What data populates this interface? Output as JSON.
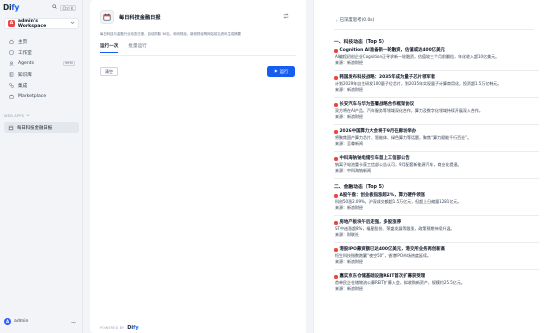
{
  "sidebar": {
    "logo": {
      "prefix": "Di",
      "accent": "fy"
    },
    "shortcut": "Ctrl K",
    "workspace": {
      "badge": "A",
      "name": "admin's Workspace"
    },
    "nav": [
      {
        "label": "主页",
        "icon": "home-icon"
      },
      {
        "label": "工作室",
        "icon": "studio-icon"
      },
      {
        "label": "Agents",
        "icon": "agents-icon",
        "badge": "BETA"
      },
      {
        "label": "知识库",
        "icon": "knowledge-icon"
      },
      {
        "label": "集成",
        "icon": "integration-icon"
      },
      {
        "label": "Marketplace",
        "icon": "marketplace-icon"
      }
    ],
    "webapps_label": "WEB APPS",
    "webapp_item": "每日科技金融日报",
    "user": {
      "initial": "A",
      "name": "admin"
    }
  },
  "app": {
    "title": "每日科技金融日报",
    "description": "每日科技与金融行业动态日报，自动抓取 36氪、和讯财经、新浪财经等网站前沿资讯生成摘要",
    "tabs": [
      "运行一次",
      "批量运行"
    ],
    "clear_label": "清空",
    "run_label": "运行",
    "powered_by": "POWERED BY",
    "brand_prefix": "Di",
    "brand_accent": "fy"
  },
  "result": {
    "status": "已深度思考(0.0s)",
    "sections": [
      {
        "heading": "一、科技动态（Top 5）",
        "items": [
          {
            "title": "Cognition AI准备新一轮融资，估值或达400亿美元",
            "lines": [
              "AI编程初创企业Cognition正寻求新一轮融资，估值较三个月前翻倍，年化收入超10亿美元。",
              "来源：新浪财经"
            ]
          },
          {
            "title": "韩国发布科技战略：2035年成为量子芯片领军者",
            "lines": [
              "计划2029年自主研发100量子位芯片，到2035年实现量子计算商用化，投资超1.5万亿韩元。",
              "来源：新浪财经"
            ]
          },
          {
            "title": "长安汽车与华为签署战略合作框架协议",
            "lines": [
              "双方将在AI产品、汽车服务等领域深化合作，算力及数字化领域持续开展深入合作。",
              "来源：新浪财经"
            ]
          },
          {
            "title": "2026中国算力大会将于9月在廊坊举办",
            "lines": [
              "将聚焦国产算力芯片、智能体、绿色算力等话题，聚焦“算力赋能千行百业”。",
              "来源：至尊新闻"
            ]
          },
          {
            "title": "中科海钠钠电储引车首上工信部公告",
            "lines": [
              "钠离子电池重卡获工信部公告认可，9月配套新能源汽车，商业化提速。",
              "来源：中科海钠新闻"
            ]
          }
        ]
      },
      {
        "heading": "二、金融动态（Top 5）",
        "items": [
          {
            "title": "A股午盘：创业板指涨超2%，算力硬件领涨",
            "lines": [
              "科创50涨2.09%，沪深成交额超1.5万亿元，但超上日缩量1281亿元。",
              "来源：新浪财经"
            ]
          },
          {
            "title": "房地产板块午后走强，多股涨停",
            "lines": [
              "ST中迪涨超8%，福星股份、荣盛发展等跟涨，政策预期持续升温。",
              "来源：财联社"
            ]
          },
          {
            "title": "港股IPO募资额已达400亿美元，港交所业务再创新高",
            "lines": [
              "恒生科技指数跑赢“夜空50”，香港IPO市场热度延续。",
              "来源：新浪财经"
            ]
          },
          {
            "title": "嘉实京东仓储基础设施REIT首次扩募获受理",
            "lines": [
              "首单民企仓储物流公募REIT扩募入会，拟收购新资产，规模约25.5亿元。",
              "来源：新浪财经"
            ]
          }
        ]
      }
    ]
  }
}
